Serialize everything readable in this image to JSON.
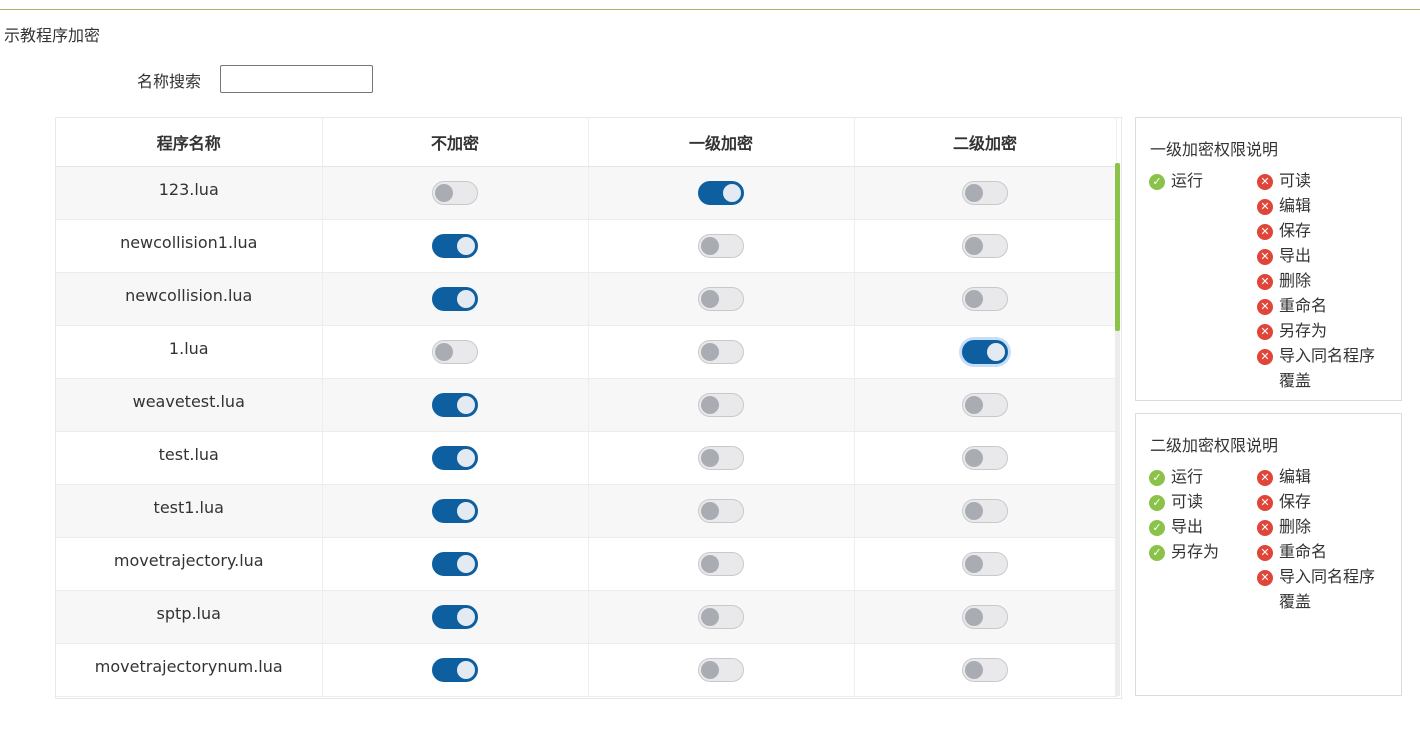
{
  "page": {
    "title": "示教程序加密"
  },
  "search": {
    "label": "名称搜索",
    "value": ""
  },
  "table": {
    "headers": [
      "程序名称",
      "不加密",
      "一级加密",
      "二级加密"
    ],
    "rows": [
      {
        "name": "123.lua",
        "level": 1
      },
      {
        "name": "newcollision1.lua",
        "level": 0
      },
      {
        "name": "newcollision.lua",
        "level": 0
      },
      {
        "name": "1.lua",
        "level": 2
      },
      {
        "name": "weavetest.lua",
        "level": 0
      },
      {
        "name": "test.lua",
        "level": 0
      },
      {
        "name": "test1.lua",
        "level": 0
      },
      {
        "name": "movetrajectory.lua",
        "level": 0
      },
      {
        "name": "sptp.lua",
        "level": 0
      },
      {
        "name": "movetrajectorynum.lua",
        "level": 0
      }
    ]
  },
  "panels": [
    {
      "title": "一级加密权限说明",
      "allowed": [
        "运行"
      ],
      "denied": [
        "可读",
        "编辑",
        "保存",
        "导出",
        "删除",
        "重命名",
        "另存为",
        "导入同名程序",
        "覆盖"
      ]
    },
    {
      "title": "二级加密权限说明",
      "allowed": [
        "运行",
        "可读",
        "导出",
        "另存为"
      ],
      "denied": [
        "编辑",
        "保存",
        "删除",
        "重命名",
        "导入同名程序",
        "覆盖"
      ]
    }
  ],
  "colors": {
    "switch_on": "#0d5fa0",
    "allowed_icon": "#8bc34a",
    "denied_icon": "#e0453a",
    "scroll_thumb": "#8bc34a"
  },
  "icons": {
    "allowed": "check-circle-icon",
    "denied": "x-circle-icon"
  }
}
